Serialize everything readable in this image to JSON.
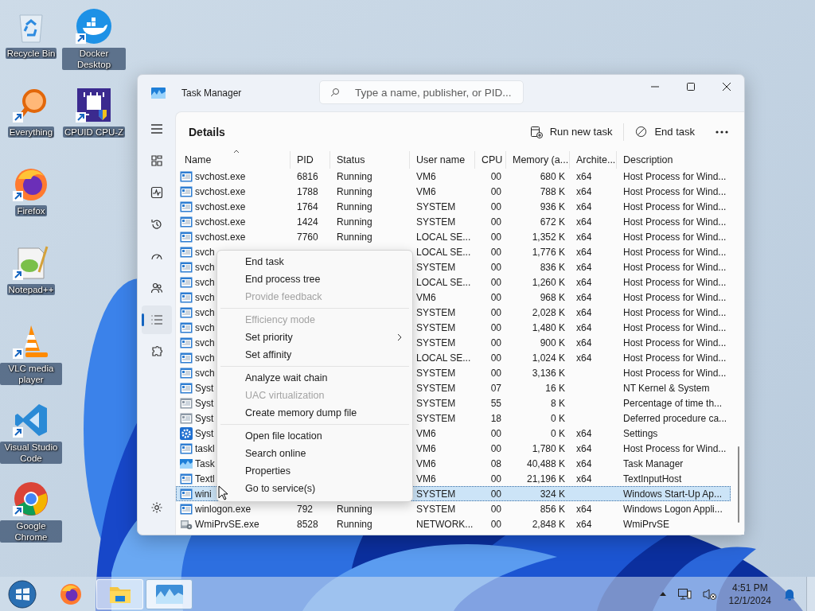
{
  "desktop_icons": [
    {
      "label": "Recycle Bin",
      "shortcut": false
    },
    {
      "label": "Docker Desktop",
      "shortcut": true
    },
    {
      "label": "Everything",
      "shortcut": true
    },
    {
      "label": "CPUID CPU-Z",
      "shortcut": true
    },
    {
      "label": "Firefox",
      "shortcut": true
    },
    {
      "label": "Notepad++",
      "shortcut": true
    },
    {
      "label": "VLC media player",
      "shortcut": true
    },
    {
      "label": "Visual Studio Code",
      "shortcut": true
    },
    {
      "label": "Google Chrome",
      "shortcut": true
    }
  ],
  "window": {
    "title": "Task Manager",
    "search": {
      "placeholder": "Type a name, publisher, or PID..."
    }
  },
  "sidebar": {
    "items": [
      {
        "selected": false
      },
      {
        "selected": false
      },
      {
        "selected": false
      },
      {
        "selected": false
      },
      {
        "selected": false
      },
      {
        "selected": true
      },
      {
        "selected": false
      }
    ]
  },
  "page": {
    "title": "Details",
    "actions": [
      "Run new task",
      "End task"
    ]
  },
  "table": {
    "columns": [
      {
        "label": "Name",
        "sorted": true
      },
      {
        "label": "PID",
        "sorted": false
      },
      {
        "label": "Status",
        "sorted": false
      },
      {
        "label": "User name",
        "sorted": false
      },
      {
        "label": "CPU",
        "sorted": false
      },
      {
        "label": "Memory (a...",
        "sorted": false
      },
      {
        "label": "Archite...",
        "sorted": false
      },
      {
        "label": "Description",
        "sorted": false
      }
    ],
    "rows": [
      {
        "kind": "app",
        "name": "svchost.exe",
        "pid": "6816",
        "status": "Running",
        "user": "VM6",
        "cpu": "00",
        "memory": "680 K",
        "arch": "x64",
        "description": "Host Process for Wind...",
        "selected": false
      },
      {
        "kind": "app",
        "name": "svchost.exe",
        "pid": "1788",
        "status": "Running",
        "user": "VM6",
        "cpu": "00",
        "memory": "788 K",
        "arch": "x64",
        "description": "Host Process for Wind...",
        "selected": false
      },
      {
        "kind": "app",
        "name": "svchost.exe",
        "pid": "1764",
        "status": "Running",
        "user": "SYSTEM",
        "cpu": "00",
        "memory": "936 K",
        "arch": "x64",
        "description": "Host Process for Wind...",
        "selected": false
      },
      {
        "kind": "app",
        "name": "svchost.exe",
        "pid": "1424",
        "status": "Running",
        "user": "SYSTEM",
        "cpu": "00",
        "memory": "672 K",
        "arch": "x64",
        "description": "Host Process for Wind...",
        "selected": false
      },
      {
        "kind": "app",
        "name": "svchost.exe",
        "pid": "7760",
        "status": "Running",
        "user": "LOCAL SE...",
        "cpu": "00",
        "memory": "1,352 K",
        "arch": "x64",
        "description": "Host Process for Wind...",
        "selected": false
      },
      {
        "kind": "app",
        "name": "svch",
        "user": "LOCAL SE...",
        "cpu": "00",
        "memory": "1,776 K",
        "arch": "x64",
        "description": "Host Process for Wind...",
        "selected": false
      },
      {
        "kind": "app",
        "name": "svch",
        "user": "SYSTEM",
        "cpu": "00",
        "memory": "836 K",
        "arch": "x64",
        "description": "Host Process for Wind...",
        "selected": false
      },
      {
        "kind": "app",
        "name": "svch",
        "user": "LOCAL SE...",
        "cpu": "00",
        "memory": "1,260 K",
        "arch": "x64",
        "description": "Host Process for Wind...",
        "selected": false
      },
      {
        "kind": "app",
        "name": "svch",
        "user": "VM6",
        "cpu": "00",
        "memory": "968 K",
        "arch": "x64",
        "description": "Host Process for Wind...",
        "selected": false
      },
      {
        "kind": "app",
        "name": "svch",
        "user": "SYSTEM",
        "cpu": "00",
        "memory": "2,028 K",
        "arch": "x64",
        "description": "Host Process for Wind...",
        "selected": false
      },
      {
        "kind": "app",
        "name": "svch",
        "user": "SYSTEM",
        "cpu": "00",
        "memory": "1,480 K",
        "arch": "x64",
        "description": "Host Process for Wind...",
        "selected": false
      },
      {
        "kind": "app",
        "name": "svch",
        "user": "SYSTEM",
        "cpu": "00",
        "memory": "900 K",
        "arch": "x64",
        "description": "Host Process for Wind...",
        "selected": false
      },
      {
        "kind": "app",
        "name": "svch",
        "user": "LOCAL SE...",
        "cpu": "00",
        "memory": "1,024 K",
        "arch": "x64",
        "description": "Host Process for Wind...",
        "selected": false
      },
      {
        "kind": "app",
        "name": "svch",
        "user": "SYSTEM",
        "cpu": "00",
        "memory": "3,136 K",
        "description": "Host Process for Wind...",
        "selected": false
      },
      {
        "kind": "app",
        "name": "Syst",
        "user": "SYSTEM",
        "cpu": "07",
        "memory": "16 K",
        "description": "NT Kernel & System",
        "selected": false
      },
      {
        "kind": "system",
        "name": "Syst",
        "user": "SYSTEM",
        "cpu": "55",
        "memory": "8 K",
        "description": "Percentage of time th...",
        "selected": false
      },
      {
        "kind": "system",
        "name": "Syst",
        "user": "SYSTEM",
        "cpu": "18",
        "memory": "0 K",
        "description": "Deferred procedure ca...",
        "selected": false
      },
      {
        "kind": "settings",
        "name": "Syst",
        "user": "VM6",
        "cpu": "00",
        "memory": "0 K",
        "arch": "x64",
        "description": "Settings",
        "selected": false
      },
      {
        "kind": "app",
        "name": "taskl",
        "user": "VM6",
        "cpu": "00",
        "memory": "1,780 K",
        "arch": "x64",
        "description": "Host Process for Wind...",
        "selected": false
      },
      {
        "kind": "monitor",
        "name": "Task",
        "user": "VM6",
        "cpu": "08",
        "memory": "40,488 K",
        "arch": "x64",
        "description": "Task Manager",
        "selected": false
      },
      {
        "kind": "app",
        "name": "Textl",
        "user": "VM6",
        "cpu": "00",
        "memory": "21,196 K",
        "arch": "x64",
        "description": "TextInputHost",
        "selected": false
      },
      {
        "kind": "app",
        "name": "wini",
        "user": "SYSTEM",
        "cpu": "00",
        "memory": "324 K",
        "description": "Windows Start-Up Ap...",
        "selected": true
      },
      {
        "kind": "app",
        "name": "winlogon.exe",
        "pid": "792",
        "status": "Running",
        "user": "SYSTEM",
        "cpu": "00",
        "memory": "856 K",
        "arch": "x64",
        "description": "Windows Logon Appli...",
        "selected": false
      },
      {
        "kind": "service",
        "name": "WmiPrvSE.exe",
        "pid": "8528",
        "status": "Running",
        "user": "NETWORK...",
        "cpu": "00",
        "memory": "2,848 K",
        "arch": "x64",
        "description": "WmiPrvSE",
        "selected": false
      }
    ]
  },
  "context_menu": {
    "groups": [
      [
        {
          "label": "End task",
          "disabled": false,
          "submenu": false
        },
        {
          "label": "End process tree",
          "disabled": false,
          "submenu": false
        },
        {
          "label": "Provide feedback",
          "disabled": true,
          "submenu": false
        }
      ],
      [
        {
          "label": "Efficiency mode",
          "disabled": true,
          "submenu": false
        },
        {
          "label": "Set priority",
          "disabled": false,
          "submenu": true
        },
        {
          "label": "Set affinity",
          "disabled": false,
          "submenu": false
        }
      ],
      [
        {
          "label": "Analyze wait chain",
          "disabled": false,
          "submenu": false
        },
        {
          "label": "UAC virtualization",
          "disabled": true,
          "submenu": false
        },
        {
          "label": "Create memory dump file",
          "disabled": false,
          "submenu": false
        }
      ],
      [
        {
          "label": "Open file location",
          "disabled": false,
          "submenu": false
        },
        {
          "label": "Search online",
          "disabled": false,
          "submenu": false
        },
        {
          "label": "Properties",
          "disabled": false,
          "submenu": false
        },
        {
          "label": "Go to service(s)",
          "disabled": false,
          "submenu": false
        }
      ]
    ]
  },
  "taskbar": {
    "apps": [
      {
        "open": false,
        "selected": false
      },
      {
        "open": false,
        "selected": false
      },
      {
        "open": true,
        "selected": false
      },
      {
        "open": true,
        "selected": true
      }
    ],
    "clock": {
      "time": "4:51 PM",
      "date": "12/1/2024"
    }
  }
}
